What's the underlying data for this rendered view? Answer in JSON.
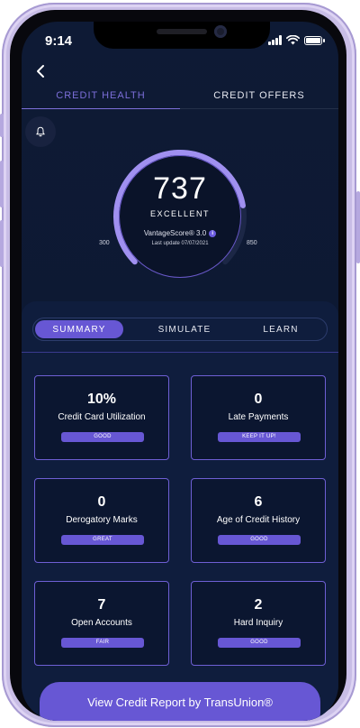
{
  "status_bar": {
    "time": "9:14"
  },
  "header": {
    "tabs": [
      {
        "label": "CREDIT HEALTH",
        "active": true
      },
      {
        "label": "CREDIT OFFERS",
        "active": false
      }
    ]
  },
  "score": {
    "value": "737",
    "rating": "EXCELLENT",
    "model": "VantageScore® 3.0",
    "last_update": "Last update 07/07/2021",
    "range_min": "300",
    "range_max": "850",
    "score_fraction": 0.797
  },
  "segments": [
    {
      "label": "SUMMARY",
      "active": true
    },
    {
      "label": "SIMULATE",
      "active": false
    },
    {
      "label": "LEARN",
      "active": false
    }
  ],
  "cards": [
    {
      "value": "10%",
      "label": "Credit Card Utilization",
      "badge": "GOOD"
    },
    {
      "value": "0",
      "label": "Late Payments",
      "badge": "KEEP IT UP!"
    },
    {
      "value": "0",
      "label": "Derogatory Marks",
      "badge": "GREAT"
    },
    {
      "value": "6",
      "label": "Age of Credit History",
      "badge": "GOOD"
    },
    {
      "value": "7",
      "label": "Open Accounts",
      "badge": "FAIR"
    },
    {
      "value": "2",
      "label": "Hard Inquiry",
      "badge": "GOOD"
    }
  ],
  "cta": {
    "label": "View Credit Report by TransUnion®"
  },
  "colors": {
    "accent": "#6757d4",
    "background": "#0e1a35",
    "panel": "#0f1d3d",
    "gauge_arc": "#a090f0"
  },
  "icons": {
    "back": "chevron-left-icon",
    "bell": "bell-icon",
    "info": "info-icon"
  }
}
